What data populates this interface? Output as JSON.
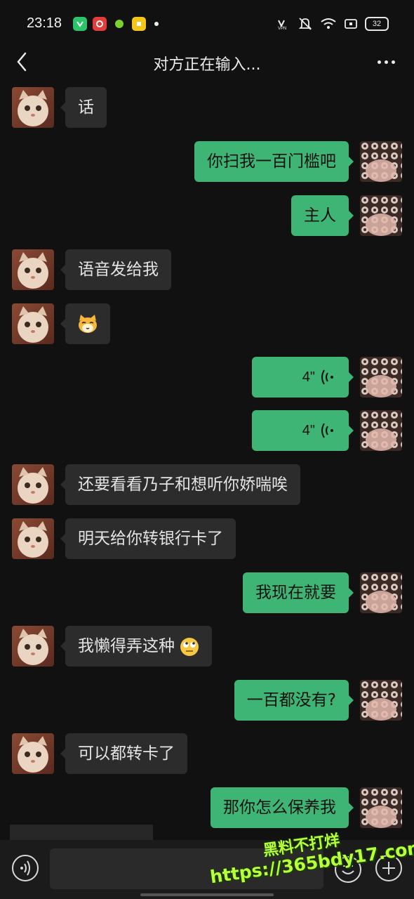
{
  "status_bar": {
    "time": "23:18",
    "battery": "32",
    "app_icons": [
      "green-app-icon",
      "red-app-icon",
      "green-dot-app-icon",
      "yellow-app-icon"
    ],
    "system_icons": [
      "vpn-icon",
      "mute-icon",
      "wifi-icon",
      "screen-icon",
      "battery-icon"
    ]
  },
  "header": {
    "title": "对方正在输入..."
  },
  "messages": [
    {
      "side": "in",
      "text": "话"
    },
    {
      "side": "out",
      "text": "你扫我一百门槛吧"
    },
    {
      "side": "out",
      "text": "主人"
    },
    {
      "side": "in",
      "text": "语音发给我"
    },
    {
      "side": "in",
      "text": "",
      "sticker": "cat-face-emoji-icon"
    },
    {
      "side": "out",
      "voice_duration": "4\""
    },
    {
      "side": "out",
      "voice_duration": "4\""
    },
    {
      "side": "in",
      "text": "还要看看乃子和想听你娇喘唉"
    },
    {
      "side": "in",
      "text": "明天给你转银行卡了"
    },
    {
      "side": "out",
      "text": "我现在就要"
    },
    {
      "side": "in",
      "text": "我懒得弄这种",
      "emoji": "rolling-eyes-emoji-icon"
    },
    {
      "side": "out",
      "text": "一百都没有?"
    },
    {
      "side": "in",
      "text": "可以都转卡了"
    },
    {
      "side": "out",
      "text": "那你怎么保养我"
    }
  ],
  "watermark": {
    "line1": "黑料不打烊",
    "line2": "https://365bdy17.com"
  },
  "colors": {
    "background": "#111111",
    "incoming_bubble": "#2c2c2c",
    "outgoing_bubble": "#3eb575",
    "watermark": "#b7ff3a"
  }
}
